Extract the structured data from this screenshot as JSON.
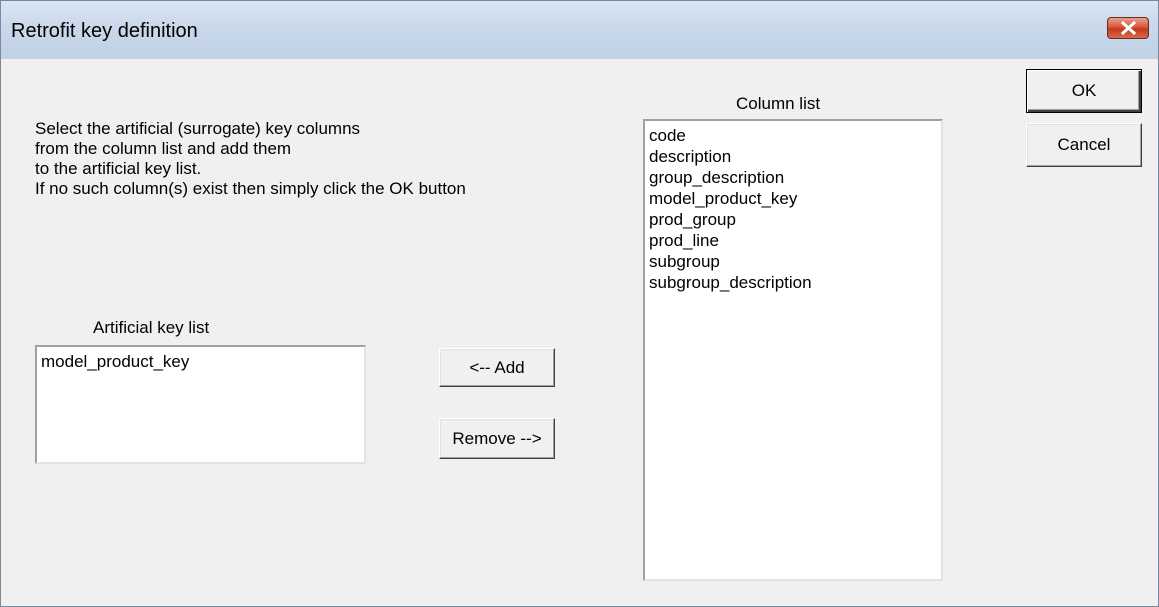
{
  "window": {
    "title": "Retrofit key definition",
    "close_icon": "close-icon"
  },
  "instructions": {
    "lines": [
      "Select the artificial (surrogate) key columns",
      "from the column list and add them",
      "to the artificial key list.",
      "If no such column(s) exist then simply click the OK button"
    ]
  },
  "artificial_key_list": {
    "label": "Artificial key list",
    "items": [
      "model_product_key"
    ]
  },
  "column_list": {
    "label": "Column list",
    "items": [
      "code",
      "description",
      "group_description",
      "model_product_key",
      "prod_group",
      "prod_line",
      "subgroup",
      "subgroup_description"
    ]
  },
  "buttons": {
    "ok": "OK",
    "cancel": "Cancel",
    "add": "<-- Add",
    "remove": "Remove -->"
  },
  "colors": {
    "titlebar": "#c9d8ea",
    "close_button": "#c9472a",
    "dialog_background": "#f0f0f0"
  }
}
